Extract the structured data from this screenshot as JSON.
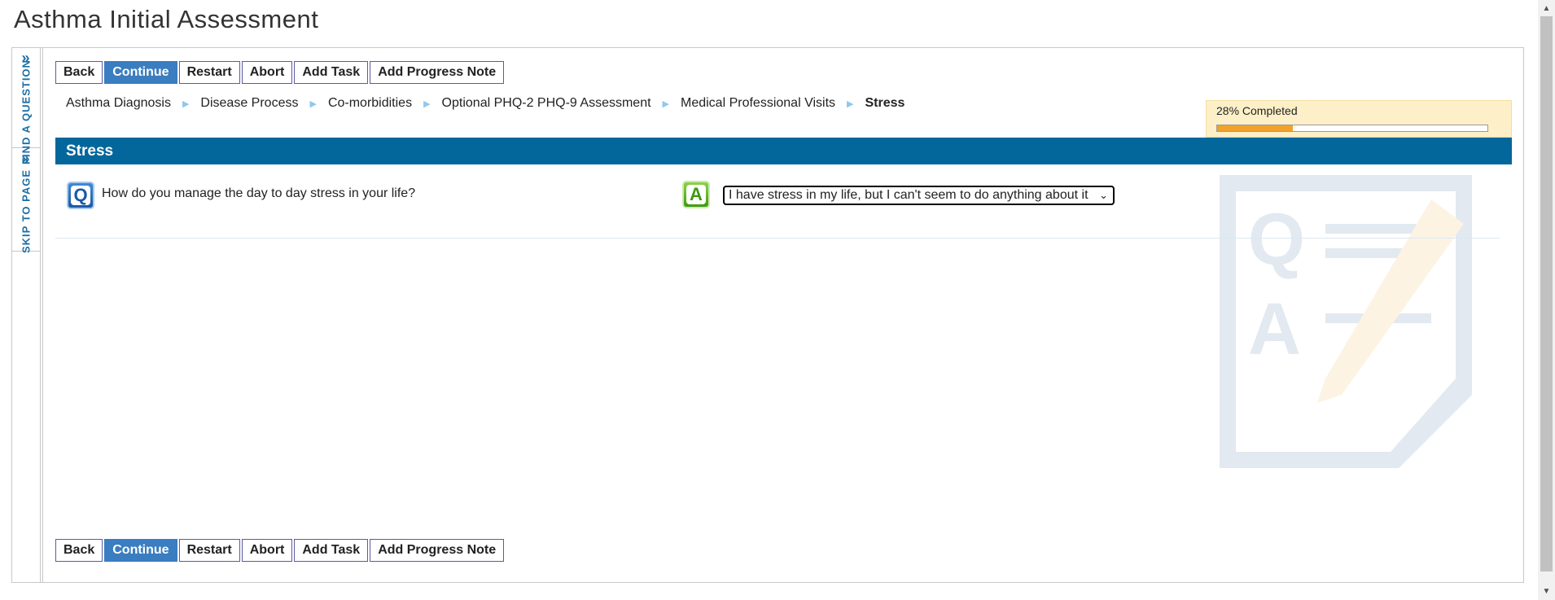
{
  "page": {
    "title": "Asthma Initial Assessment"
  },
  "side_tabs": [
    {
      "label": "FIND A QUESTION",
      "icon": "double-chevron-right-icon"
    },
    {
      "label": "SKIP TO PAGE",
      "icon": "double-chevron-right-icon"
    }
  ],
  "toolbar": {
    "back": "Back",
    "continue": "Continue",
    "restart": "Restart",
    "abort": "Abort",
    "add_task": "Add Task",
    "add_progress_note": "Add Progress Note"
  },
  "breadcrumb": {
    "items": [
      "Asthma Diagnosis",
      "Disease Process",
      "Co-morbidities",
      "Optional PHQ-2 PHQ-9 Assessment",
      "Medical Professional Visits",
      "Stress"
    ],
    "separator": "▶"
  },
  "progress": {
    "label": "28% Completed",
    "percent": 28,
    "fill_color": "#f2a22a"
  },
  "section": {
    "title": "Stress",
    "bar_color": "#03679b"
  },
  "question": {
    "badge": "Q",
    "text": "How do you manage the day to day stress in your life?"
  },
  "answer": {
    "badge": "A",
    "selected": "I have stress in my life, but I can't seem to do anything about it"
  },
  "icons": {
    "dropdown": "chevron-down-icon",
    "scroll_up": "▲",
    "scroll_down": "▼"
  },
  "colors": {
    "primary_button": "#3a7dc0",
    "accent": "#1c6ea4"
  }
}
